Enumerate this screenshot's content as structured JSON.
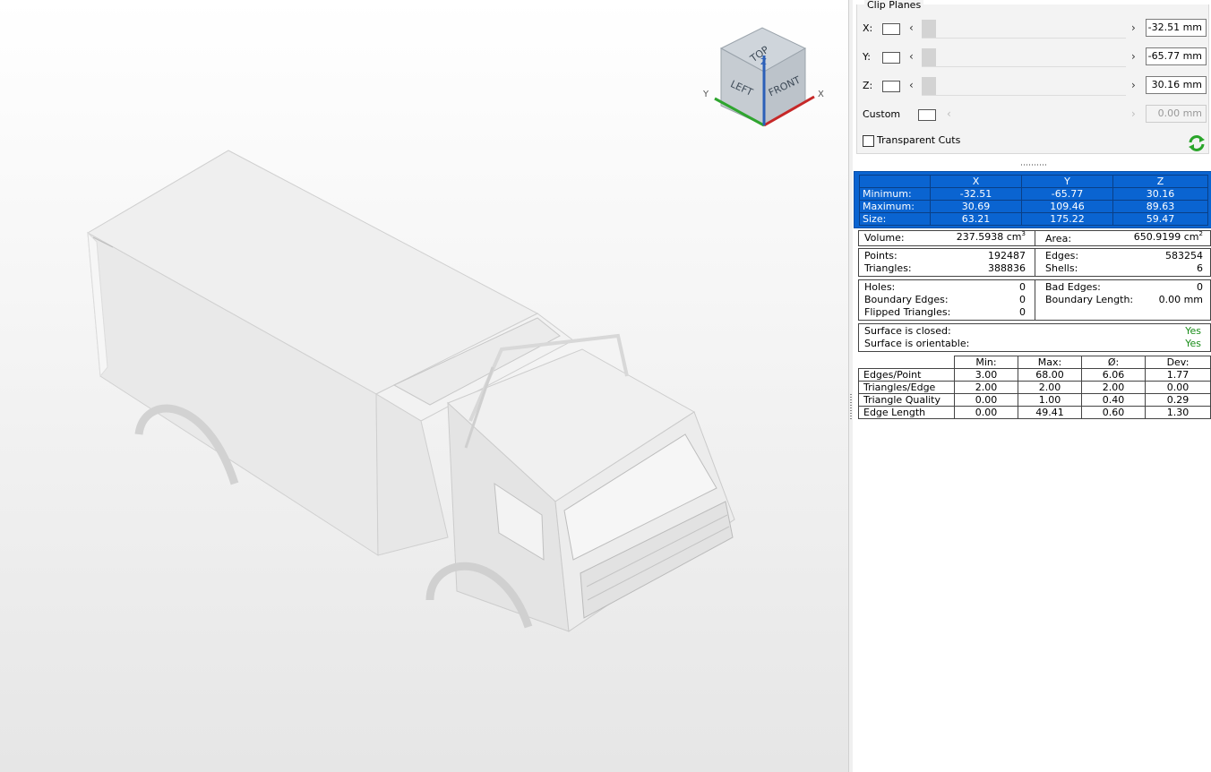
{
  "clip_planes": {
    "title": "Clip Planes",
    "rows": [
      {
        "label": "X:",
        "value": "-32.51 mm"
      },
      {
        "label": "Y:",
        "value": "-65.77 mm"
      },
      {
        "label": "Z:",
        "value": "30.16 mm"
      },
      {
        "label": "Custom",
        "value": "0.00 mm"
      }
    ],
    "transparent_cuts_label": "Transparent Cuts",
    "transparent_cuts_checked": false
  },
  "view_cube": {
    "faces": {
      "top": "TOP",
      "left": "LEFT",
      "front": "FRONT"
    },
    "axes": {
      "x": "X",
      "y": "Y",
      "z": "Z"
    }
  },
  "bounding_box": {
    "headers": [
      "X",
      "Y",
      "Z"
    ],
    "rows": [
      {
        "label": "Minimum:",
        "values": [
          "-32.51",
          "-65.77",
          "30.16"
        ]
      },
      {
        "label": "Maximum:",
        "values": [
          "30.69",
          "109.46",
          "89.63"
        ]
      },
      {
        "label": "Size:",
        "values": [
          "63.21",
          "175.22",
          "59.47"
        ]
      }
    ]
  },
  "volume": {
    "label": "Volume:",
    "value": "237.5938 cm",
    "unit_exp": "3",
    "area_label": "Area:",
    "area_value": "650.9199 cm",
    "area_exp": "2"
  },
  "mesh_counts": {
    "points_label": "Points:",
    "points": "192487",
    "triangles_label": "Triangles:",
    "triangles": "388836",
    "edges_label": "Edges:",
    "edges": "583254",
    "shells_label": "Shells:",
    "shells": "6"
  },
  "errors": {
    "holes_label": "Holes:",
    "holes": "0",
    "boundary_edges_label": "Boundary Edges:",
    "boundary_edges": "0",
    "flipped_label": "Flipped Triangles:",
    "flipped": "0",
    "bad_edges_label": "Bad Edges:",
    "bad_edges": "0",
    "boundary_length_label": "Boundary Length:",
    "boundary_length": "0.00 mm"
  },
  "surface": {
    "closed_label": "Surface is closed:",
    "closed": "Yes",
    "orientable_label": "Surface is orientable:",
    "orientable": "Yes"
  },
  "statistics": {
    "headers": [
      "Min:",
      "Max:",
      "Ø:",
      "Dev:"
    ],
    "rows": [
      {
        "label": "Edges/Point",
        "values": [
          "3.00",
          "68.00",
          "6.06",
          "1.77"
        ]
      },
      {
        "label": "Triangles/Edge",
        "values": [
          "2.00",
          "2.00",
          "2.00",
          "0.00"
        ]
      },
      {
        "label": "Triangle Quality",
        "values": [
          "0.00",
          "1.00",
          "0.40",
          "0.29"
        ]
      },
      {
        "label": "Edge Length",
        "values": [
          "0.00",
          "49.41",
          "0.60",
          "1.30"
        ]
      }
    ]
  },
  "colors": {
    "selection_blue": "#0a64d1",
    "yes_green": "#178c17",
    "refresh_green": "#2aa52a"
  }
}
